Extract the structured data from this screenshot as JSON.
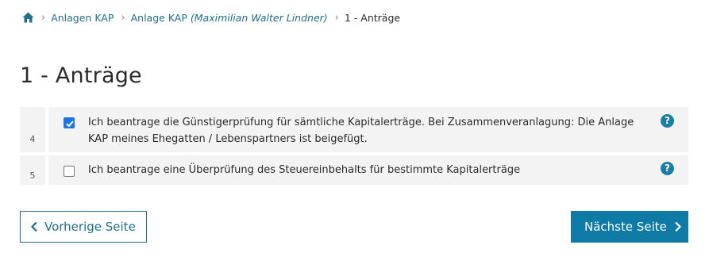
{
  "breadcrumb": {
    "home_icon": "home-icon",
    "items": [
      {
        "label": "Anlagen KAP"
      },
      {
        "label": "Anlage KAP",
        "suffix": "(Maximilian Walter Lindner)"
      }
    ],
    "current": "1 - Anträge"
  },
  "page": {
    "title": "1 - Anträge"
  },
  "rows": [
    {
      "number": "4",
      "checked": true,
      "label": "Ich beantrage die Günstigerprüfung für sämtliche Kapitalerträge. Bei Zusammenveranlagung: Die Anlage KAP meines Ehegatten / Lebenspartners ist beigefügt.",
      "help": "?"
    },
    {
      "number": "5",
      "checked": false,
      "label": "Ich beantrage eine Überprüfung des Steuereinbehalts für bestimmte Kapitalerträge",
      "help": "?"
    }
  ],
  "navigation": {
    "prev_label": "Vorherige Seite",
    "next_label": "Nächste Seite"
  },
  "colors": {
    "link": "#1e6f8f",
    "primary_button": "#0e7aa6",
    "help_icon": "#1a7fa8",
    "checkbox_checked": "#1a73e8",
    "row_background": "#f3f3f3"
  }
}
